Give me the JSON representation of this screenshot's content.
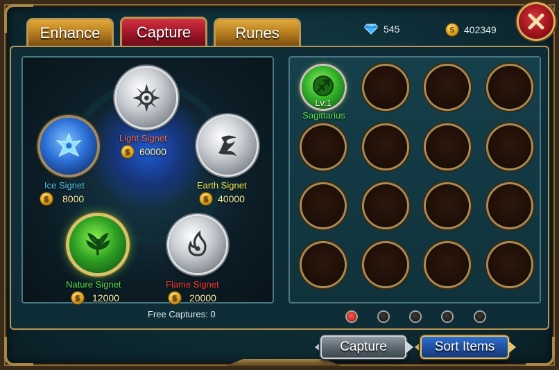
{
  "tabs": [
    {
      "label": "Enhance",
      "active": false
    },
    {
      "label": "Capture",
      "active": true
    },
    {
      "label": "Runes",
      "active": false
    }
  ],
  "currency": {
    "gems": "545",
    "gold": "402349"
  },
  "signets": {
    "light": {
      "name": "Light Signet",
      "cost": "60000",
      "color": "#ff6a4a"
    },
    "earth": {
      "name": "Earth Signet",
      "cost": "40000",
      "color": "#f4ee58"
    },
    "ice": {
      "name": "Ice Signet",
      "cost": "8000",
      "color": "#58c8f0"
    },
    "nature": {
      "name": "Nature Signet",
      "cost": "12000",
      "color": "#5ee04a"
    },
    "flame": {
      "name": "Flame Signet",
      "cost": "20000",
      "color": "#ff3b2f"
    }
  },
  "free_captures": "Free Captures: 0",
  "inventory": {
    "first_item": {
      "level": "Lv.1",
      "name": "Sagittarius",
      "icon": "sagittarius-icon"
    },
    "total_slots": 16
  },
  "pagination": {
    "pages": 5,
    "current": 1
  },
  "buttons": {
    "capture": "Capture",
    "sort": "Sort Items"
  },
  "colors": {
    "tab_active": "#b01c2d",
    "tab_inactive": "#d49a2f",
    "gold_trim": "#b99653"
  }
}
